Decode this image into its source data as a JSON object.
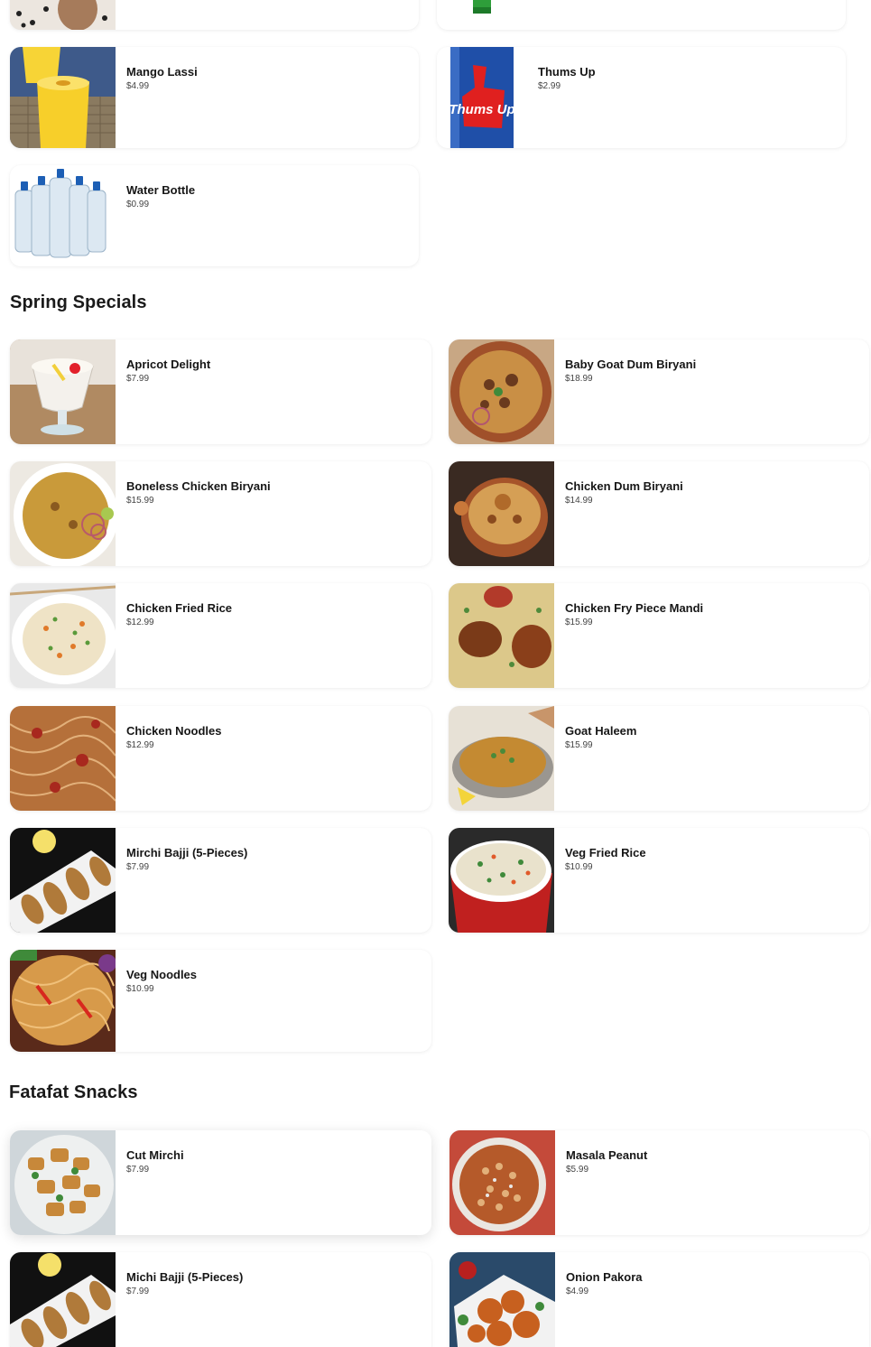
{
  "beverages": {
    "items": [
      {
        "name": "Mango Lassi",
        "price": "$4.99",
        "image": "mango-lassi-image"
      },
      {
        "name": "Thums Up",
        "price": "$2.99",
        "image": "thums-up-can-image"
      },
      {
        "name": "Water Bottle",
        "price": "$0.99",
        "image": "water-bottle-image"
      }
    ],
    "thumbs_up_can_text": "Thums Up"
  },
  "spring_specials": {
    "title": "Spring Specials",
    "items": [
      {
        "name": "Apricot Delight",
        "price": "$7.99"
      },
      {
        "name": "Baby Goat Dum Biryani",
        "price": "$18.99"
      },
      {
        "name": "Boneless Chicken Biryani",
        "price": "$15.99"
      },
      {
        "name": "Chicken Dum Biryani",
        "price": "$14.99"
      },
      {
        "name": "Chicken Fried Rice",
        "price": "$12.99"
      },
      {
        "name": "Chicken Fry Piece Mandi",
        "price": "$15.99"
      },
      {
        "name": "Chicken Noodles",
        "price": "$12.99"
      },
      {
        "name": "Goat Haleem",
        "price": "$15.99"
      },
      {
        "name": "Mirchi Bajji (5-Pieces)",
        "price": "$7.99"
      },
      {
        "name": "Veg Fried Rice",
        "price": "$10.99"
      },
      {
        "name": "Veg Noodles",
        "price": "$10.99"
      }
    ]
  },
  "fatafat_snacks": {
    "title": "Fatafat Snacks",
    "items": [
      {
        "name": "Cut Mirchi",
        "price": "$7.99"
      },
      {
        "name": "Masala Peanut",
        "price": "$5.99"
      },
      {
        "name": "Michi Bajji (5-Pieces)",
        "price": "$7.99"
      },
      {
        "name": "Onion Pakora",
        "price": "$4.99"
      }
    ]
  },
  "colors": {
    "card_bg": "#ffffff",
    "text": "#161616",
    "price_text": "#444444"
  }
}
